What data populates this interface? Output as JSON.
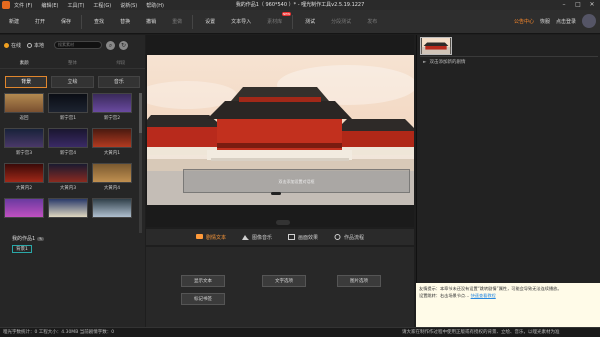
{
  "window": {
    "title": "我的作品1（ 960*540 ）* - 哩光制作工具v2.5.19.1227",
    "menus": [
      "文件 (F)",
      "编辑(E)",
      "工具(T)",
      "工程(G)",
      "说新(S)",
      "帮助(H)"
    ],
    "controls": [
      "–",
      "□",
      "✕"
    ]
  },
  "toolbar": {
    "buttons": [
      {
        "label": "新建",
        "enabled": true
      },
      {
        "label": "打开",
        "enabled": true
      },
      {
        "label": "保存",
        "enabled": true
      },
      {
        "label": "查找",
        "enabled": true
      },
      {
        "label": "替换",
        "enabled": true
      },
      {
        "label": "撤销",
        "enabled": true
      },
      {
        "label": "重做",
        "enabled": false
      },
      {
        "label": "设置",
        "enabled": true
      },
      {
        "label": "文本导入",
        "enabled": true
      },
      {
        "label": "素材库",
        "enabled": false,
        "badge": "NEW"
      },
      {
        "label": "测试",
        "enabled": true
      },
      {
        "label": "分段测试",
        "enabled": false
      },
      {
        "label": "发布",
        "enabled": false
      }
    ],
    "right": {
      "member": "公告中心",
      "vip": "恢服",
      "login": "点击登录"
    }
  },
  "left": {
    "source_options": [
      "在线",
      "本地"
    ],
    "selected_source": "在线",
    "search_placeholder": "搜素素材",
    "categories_top": [
      "素颜",
      "整体",
      "绿段"
    ],
    "categories_main": [
      "背景",
      "立绘",
      "音乐"
    ],
    "active_category": "背景",
    "thumbnails": [
      {
        "caption": "返回",
        "colors": [
          "#b38a50",
          "#7a5030"
        ]
      },
      {
        "caption": "新宁宫1",
        "colors": [
          "#0a0d14",
          "#1c2330"
        ]
      },
      {
        "caption": "新宁宫2",
        "colors": [
          "#3a2a5a",
          "#6a4aa0"
        ]
      },
      {
        "caption": "新宁宫3",
        "colors": [
          "#18223a",
          "#4a3868"
        ]
      },
      {
        "caption": "新宁宫4",
        "colors": [
          "#1a1630",
          "#3a2a66"
        ]
      },
      {
        "caption": "大黄内1",
        "colors": [
          "#4a1a10",
          "#b23a20"
        ]
      },
      {
        "caption": "大黄内2",
        "colors": [
          "#3a0a08",
          "#a02818"
        ]
      },
      {
        "caption": "大黄内3",
        "colors": [
          "#1a1a30",
          "#8a2a20"
        ]
      },
      {
        "caption": "大黄内4",
        "colors": [
          "#7a5a30",
          "#c09050"
        ]
      },
      {
        "caption": "",
        "colors": [
          "#6a3aa0",
          "#c050c0"
        ]
      },
      {
        "caption": "",
        "colors": [
          "#2a3a6a",
          "#e0d8c0"
        ]
      },
      {
        "caption": "",
        "colors": [
          "#30404a",
          "#b0c0d0"
        ]
      }
    ],
    "project": {
      "title": "我的作品1",
      "pill": "✎",
      "item": "背景1"
    }
  },
  "editor": {
    "textbox_hint": "双击添加设置对话框",
    "tabs": [
      "剧情文本",
      "图像音乐",
      "画面效果",
      "作品流程"
    ],
    "active_tab": "剧情文本",
    "actions": [
      "显示文本",
      "文字选项",
      "图片选项",
      "标记书签"
    ]
  },
  "right": {
    "add_scene": "双击添加新的剧情",
    "tip": {
      "lead": "友情提示：本章节未还没有设置",
      "quote": "“跳转剧情”",
      "rest": "属性，可能会导致无法连续播放。",
      "sub": "设置跳转：右击场景节点…",
      "link": "快速查看教程"
    }
  },
  "status": {
    "left": "哩光字数统计：0 工程大小：4.30MB 当前剧情字数：0",
    "right": "请大家在制作作过程中使用正版或有授权的背景、立绘、音乐，以哩光素材为准"
  },
  "colors": {
    "accent": "#ff8a2a",
    "selected_border": "#e0862d",
    "project_item_border": "#2aa8a8"
  }
}
